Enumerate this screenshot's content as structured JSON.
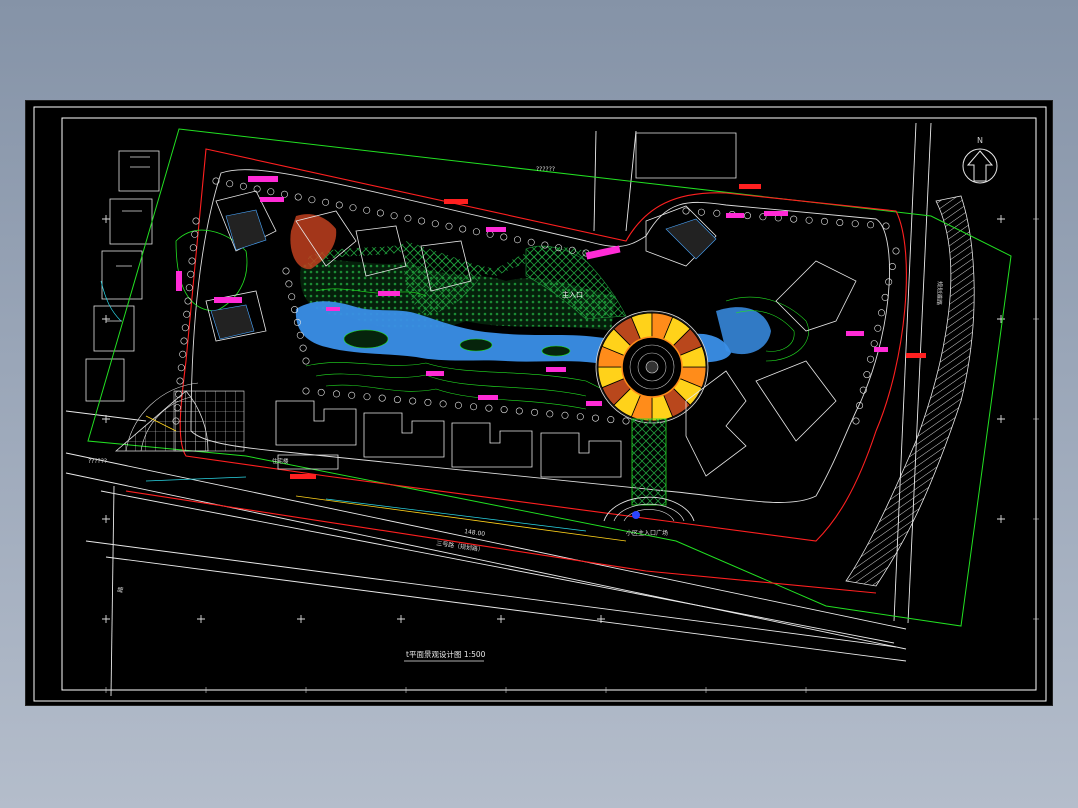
{
  "viewer": {
    "background": "#000000",
    "backdrop_color": "#8a97aa"
  },
  "drawing": {
    "title_block": "t平面景观设计图  1:500",
    "north_label": "N",
    "colors": {
      "frame": "#ffffff",
      "road": "#ffffff",
      "site_boundary": "#ff2020",
      "landscape_line": "#22e022",
      "water": "#3a8fe8",
      "plaza_orange": "#ff8c1a",
      "plaza_yellow": "#ffd21a",
      "hedge_green": "#1e9a3a",
      "magenta_label": "#ff2bd6",
      "cyan_detail": "#2ad7e6",
      "red_paving": "#c0401e"
    },
    "labels": {
      "entrance_label": "主入口",
      "road_label_bottom": "三号路（规划路）",
      "road_label_right": "规划道路",
      "road_label_left": "路",
      "gate_label": "小区主入口广场",
      "grid_left": "A",
      "misc_unknowns": "??????",
      "level_label": "148.00",
      "building_tag": "住宅楼"
    }
  }
}
